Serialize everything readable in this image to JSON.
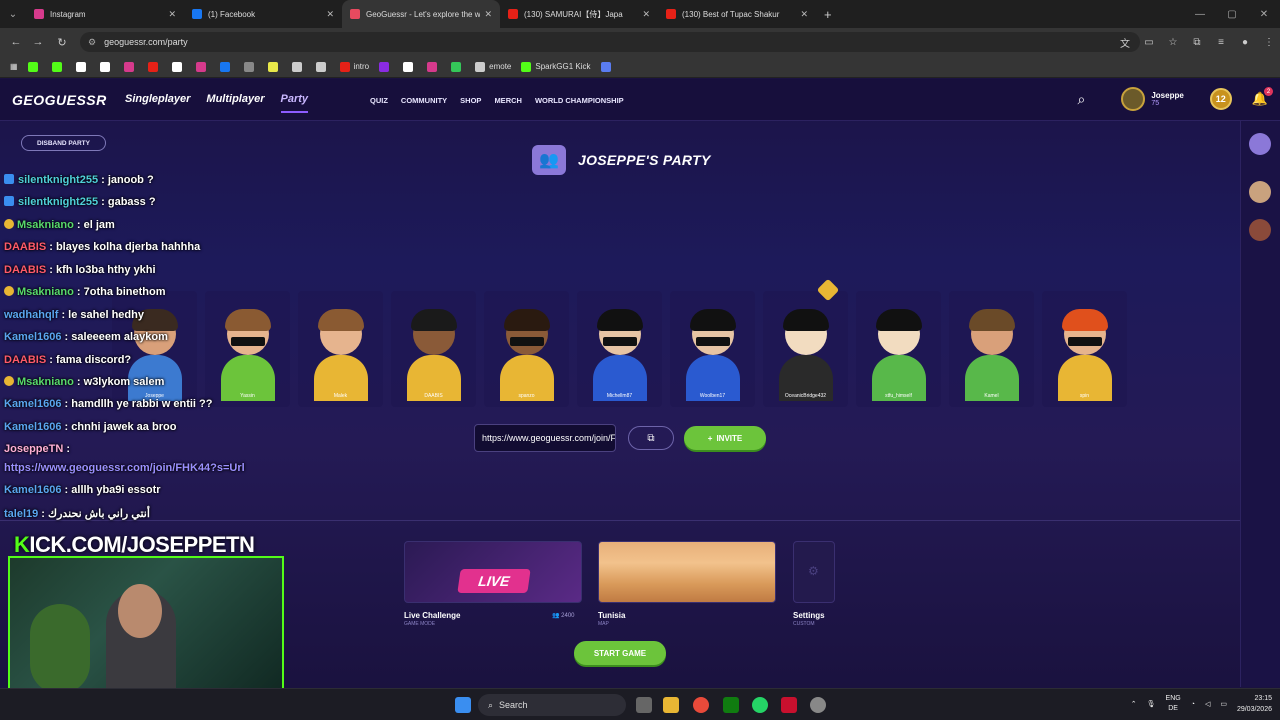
{
  "browser": {
    "tabs": [
      {
        "title": "Instagram",
        "color": "#d63a8c"
      },
      {
        "title": "(1) Facebook",
        "color": "#1877f2"
      },
      {
        "title": "GeoGuessr - Let's explore the w",
        "color": "#e84a5f",
        "active": true
      },
      {
        "title": "(130) SAMURAI【侍】Japa",
        "color": "#e62117"
      },
      {
        "title": "(130) Best of Tupac Shakur",
        "color": "#e62117"
      }
    ],
    "url": "geoguessr.com/party",
    "bookmarks": [
      {
        "label": "",
        "color": "#53fc18"
      },
      {
        "label": "",
        "color": "#53fc18"
      },
      {
        "label": "",
        "color": "#ffffff"
      },
      {
        "label": "",
        "color": "#ffffff"
      },
      {
        "label": "",
        "color": "#d63a8c"
      },
      {
        "label": "",
        "color": "#e62117"
      },
      {
        "label": "",
        "color": "#ffffff"
      },
      {
        "label": "",
        "color": "#d63a8c"
      },
      {
        "label": "",
        "color": "#1877f2"
      },
      {
        "label": "",
        "color": "#888888"
      },
      {
        "label": "",
        "color": "#e8e84a"
      },
      {
        "label": "",
        "color": "#cccccc"
      },
      {
        "label": "",
        "color": "#cccccc"
      },
      {
        "label": "intro",
        "color": "#e62117"
      },
      {
        "label": "",
        "color": "#8a2be2"
      },
      {
        "label": "",
        "color": "#ffffff"
      },
      {
        "label": "",
        "color": "#d63a8c"
      },
      {
        "label": "",
        "color": "#35c759"
      },
      {
        "label": "emote",
        "color": "#cccccc"
      },
      {
        "label": "SparkGG1 Kick",
        "color": "#53fc18"
      },
      {
        "label": "",
        "color": "#5a7cf0"
      }
    ]
  },
  "site": {
    "logo": "GEOGUESSR",
    "nav": [
      "Singleplayer",
      "Multiplayer",
      "Party"
    ],
    "subnav": [
      "QUIZ",
      "COMMUNITY",
      "SHOP",
      "MERCH",
      "WORLD CHAMPIONSHIP"
    ],
    "user": {
      "name": "Joseppe",
      "level_points": "75",
      "level": "12",
      "notifications": "2"
    },
    "disband_label": "DISBAND PARTY",
    "party_title": "JOSEPPE'S PARTY",
    "players": [
      {
        "name": "Joseppe",
        "skin": "#d9a07a",
        "hair": "#3a2a20",
        "shirt": "#3c7ad0",
        "glasses": false
      },
      {
        "name": "Yassin",
        "skin": "#e6b48e",
        "hair": "#8a5a32",
        "shirt": "#6cc43b",
        "glasses": true
      },
      {
        "name": "Malek",
        "skin": "#e6b48e",
        "hair": "#8a5a32",
        "shirt": "#e8b634",
        "glasses": false
      },
      {
        "name": "DAABIS",
        "skin": "#8a5a38",
        "hair": "#1a1a1a",
        "shirt": "#e8b634",
        "glasses": false
      },
      {
        "name": "spanzo",
        "skin": "#8a5a38",
        "hair": "#2a1a10",
        "shirt": "#e8b634",
        "glasses": true
      },
      {
        "name": "Michellm87",
        "skin": "#e6c4a4",
        "hair": "#111111",
        "shirt": "#2a5ad0",
        "glasses": true
      },
      {
        "name": "Woolben17",
        "skin": "#e6c4a4",
        "hair": "#111111",
        "shirt": "#2a5ad0",
        "glasses": true
      },
      {
        "name": "OceanicBridge432",
        "skin": "#f2dcc0",
        "hair": "#111111",
        "shirt": "#2a2a2a",
        "glasses": false
      },
      {
        "name": "stfu_himself",
        "skin": "#f2dcc0",
        "hair": "#111111",
        "shirt": "#58b84a",
        "glasses": false
      },
      {
        "name": "Kamel",
        "skin": "#d9a07a",
        "hair": "#6a4a28",
        "shirt": "#58b84a",
        "glasses": false
      },
      {
        "name": "spin",
        "skin": "#e6b48e",
        "hair": "#e0501c",
        "shirt": "#e8b634",
        "glasses": true
      }
    ],
    "invite_link": "https://www.geoguessr.com/join/FHK44?s=Url",
    "invite_label": "INVITE",
    "options": [
      {
        "label": "Live Challenge",
        "sub": "GAME MODE",
        "count": "2400"
      },
      {
        "label": "Tunisia",
        "sub": "MAP"
      },
      {
        "label": "Settings",
        "sub": "CUSTOM"
      }
    ],
    "live_badge": "LIVE",
    "start_label": "START GAME"
  },
  "chat": [
    {
      "user": "silentknight255",
      "text": " : janoob ?",
      "cls": "user-blue",
      "badge": "b"
    },
    {
      "user": "silentknight255",
      "text": " : gabass ?",
      "cls": "user-blue",
      "badge": "b"
    },
    {
      "user": "Msakniano",
      "text": " : el jam",
      "cls": "user-green",
      "badge": "g"
    },
    {
      "user": "DAABIS",
      "text": " : blayes kolha djerba hahhha",
      "cls": "user-red",
      "badge": ""
    },
    {
      "user": "DAABIS",
      "text": " : kfh lo3ba hthy ykhi",
      "cls": "user-red",
      "badge": ""
    },
    {
      "user": "Msakniano",
      "text": " : 7otha binethom",
      "cls": "user-green",
      "badge": "g"
    },
    {
      "user": "wadhahqlf",
      "text": " : le sahel hedhy",
      "cls": "user-lblue",
      "badge": ""
    },
    {
      "user": "Kamel1606",
      "text": " : saleeeem alaykom",
      "cls": "user-lblue",
      "badge": ""
    },
    {
      "user": "DAABIS",
      "text": " : fama discord?",
      "cls": "user-red",
      "badge": ""
    },
    {
      "user": "Msakniano",
      "text": " : w3lykom salem",
      "cls": "user-green",
      "badge": "g"
    },
    {
      "user": "Kamel1606",
      "text": " : hamdllh ye rabbi w entii ??",
      "cls": "user-lblue",
      "badge": ""
    },
    {
      "user": "Kamel1606",
      "text": " : chnhi jawek aa broo",
      "cls": "user-lblue",
      "badge": ""
    },
    {
      "user": "JoseppeTN",
      "text": " :",
      "cls": "user-pink",
      "badge": ""
    },
    {
      "user": "",
      "text": "https://www.geoguessr.com/join/FHK44?s=Url",
      "cls": "link",
      "badge": ""
    },
    {
      "user": "Kamel1606",
      "text": " : alllh yba9i essotr",
      "cls": "user-lblue",
      "badge": ""
    },
    {
      "user": "talel19",
      "text": " : أنتي راني باش نحندرك",
      "cls": "user-lblue",
      "badge": ""
    }
  ],
  "kick_label_k": "K",
  "kick_label_rest": "ICK.COM/JOSEPPETN",
  "taskbar": {
    "search": "Search",
    "lang": "ENG",
    "region": "DE",
    "time": "23:15",
    "date": "29/03/2026"
  }
}
